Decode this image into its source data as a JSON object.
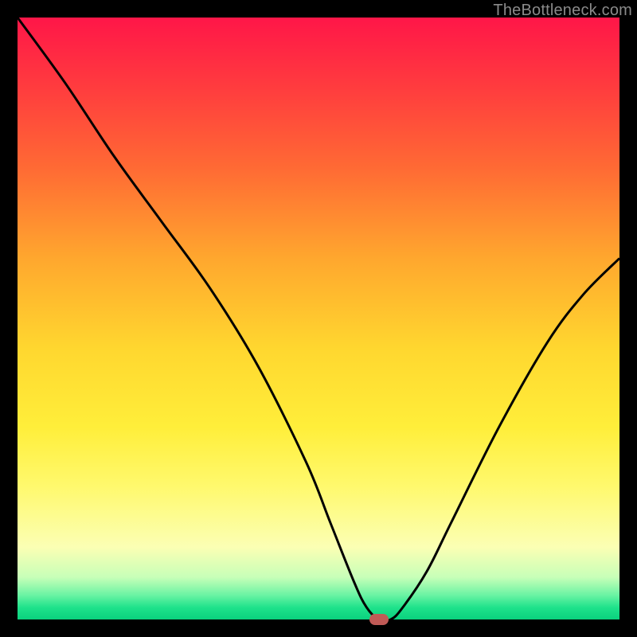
{
  "watermark": "TheBottleneck.com",
  "chart_data": {
    "type": "line",
    "title": "",
    "xlabel": "",
    "ylabel": "",
    "xlim": [
      0,
      100
    ],
    "ylim": [
      0,
      100
    ],
    "grid": false,
    "legend": false,
    "series": [
      {
        "name": "bottleneck-curve",
        "x": [
          0,
          8,
          16,
          24,
          32,
          40,
          48,
          52,
          56,
          58,
          60,
          62,
          64,
          68,
          72,
          80,
          88,
          94,
          100
        ],
        "y": [
          100,
          89,
          77,
          66,
          55,
          42,
          26,
          16,
          6,
          2,
          0,
          0,
          2,
          8,
          16,
          32,
          46,
          54,
          60
        ]
      }
    ],
    "marker": {
      "x": 60,
      "y": 0
    },
    "background_gradient": {
      "top_color": "#ff1648",
      "mid_color": "#ffe53a",
      "bottom_color": "#0ad17e"
    }
  }
}
